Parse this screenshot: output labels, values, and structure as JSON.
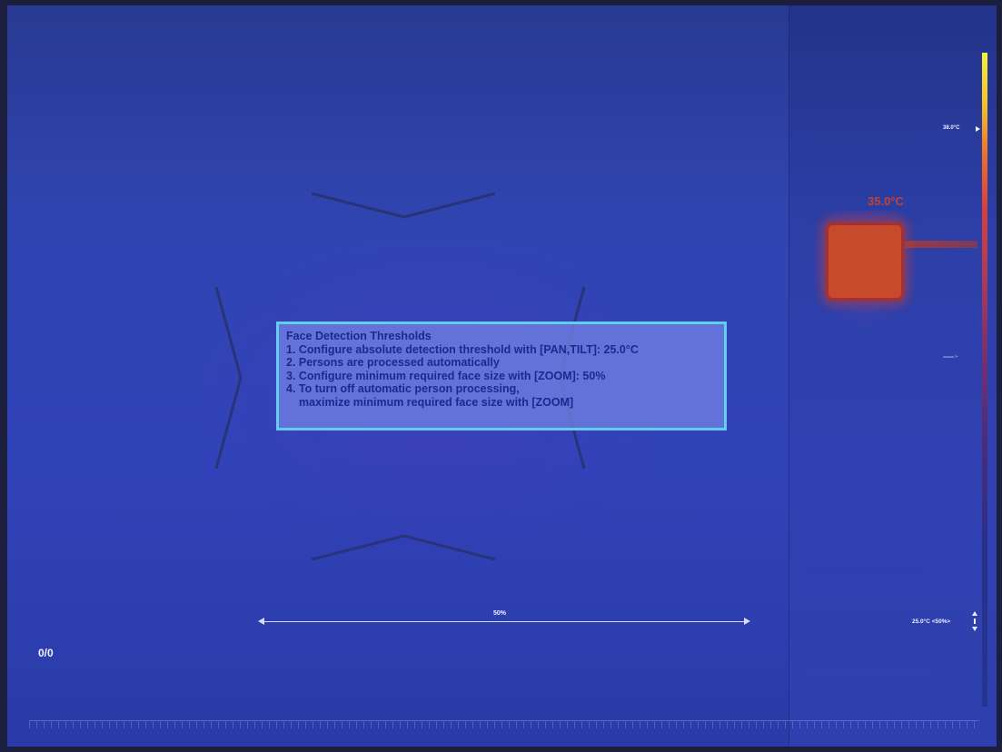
{
  "overlay": {
    "title": "Face Detection Thresholds",
    "lines": [
      "1. Configure absolute detection threshold with [PAN,TILT]: 25.0°C",
      "2. Persons are processed automatically",
      "3. Configure minimum required face size with [ZOOM]: 50%",
      "4. To turn off automatic person processing,",
      "maximize minimum required face size with [ZOOM]"
    ]
  },
  "zoom_indicator": {
    "label": "50%",
    "value_percent": 50
  },
  "counter": "0/0",
  "color_scale": {
    "max_label": "38.0°C",
    "colors": [
      "#f4f23a",
      "#ee6b2a",
      "#b13a55",
      "#2a2f88"
    ]
  },
  "hot_object": {
    "label": "35.0°C",
    "color": "#c84a2c"
  },
  "threshold_readout": "25.0°C <50%>",
  "icons": {
    "scale_pointer": "triangle-right-icon",
    "adjust": "up-down-arrows-icon"
  }
}
